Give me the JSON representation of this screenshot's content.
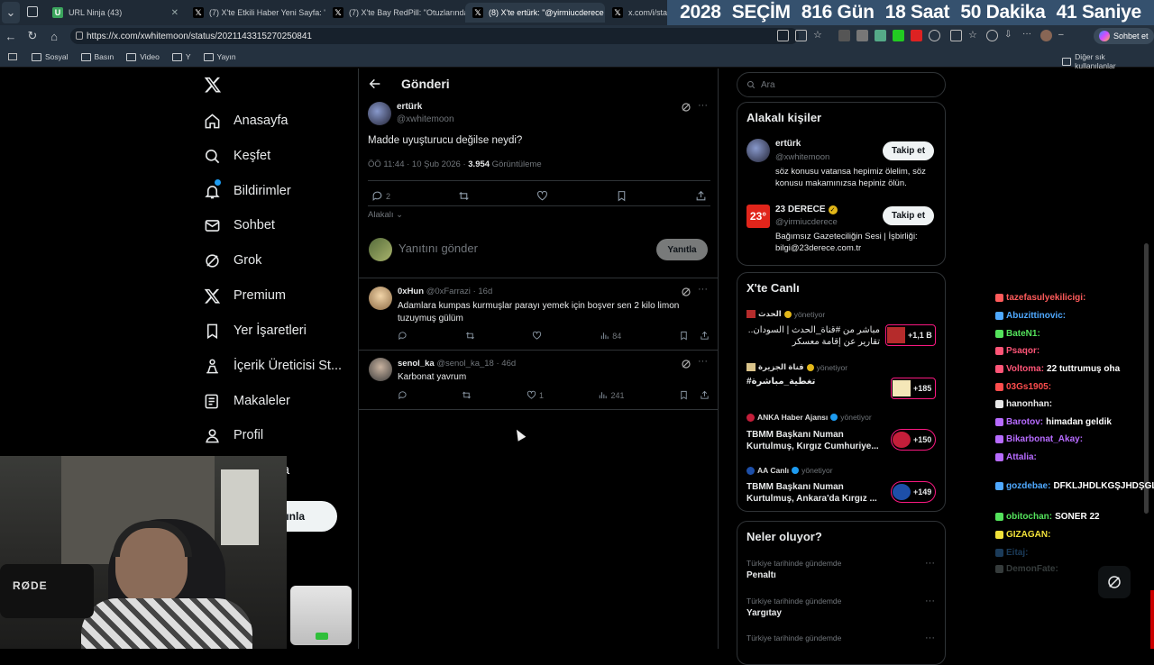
{
  "browser": {
    "tabs": [
      {
        "label": "URL Ninja (43)"
      },
      {
        "label": "(7) X'te Etkili Haber Yeni Sayfa: \"E"
      },
      {
        "label": "(7) X'te Bay RedPill: \"Otuzlarında"
      },
      {
        "label": "(8) X'te ertürk: \"@yirmiucderece b"
      },
      {
        "label": "x.com/i/status"
      }
    ],
    "url": "https://x.com/xwhitemoon/status/2021143315270250841",
    "sohbet_label": "Sohbet et",
    "bookmarks": [
      "Sosyal",
      "Basın",
      "Video",
      "Y",
      "Yayın"
    ],
    "other_bookmarks": "Diğer sık kullanılanlar"
  },
  "countdown": {
    "year": "2028",
    "label": "SEÇİM",
    "days": "816 Gün",
    "hours": "18 Saat",
    "minutes": "50 Dakika",
    "seconds": "41 Saniye"
  },
  "nav": {
    "items": [
      "Anasayfa",
      "Keşfet",
      "Bildirimler",
      "Sohbet",
      "Grok",
      "Premium",
      "Yer İşaretleri",
      "İçerik Üreticisi St...",
      "Makaleler",
      "Profil"
    ],
    "partial_item": "a",
    "post_button": "ınla"
  },
  "post": {
    "header": "Gönderi",
    "author_name": "ertürk",
    "author_handle": "@xwhitemoon",
    "text": "Madde uyuşturucu değilse neydi?",
    "meta_time": "ÖÖ 11:44 · 10 Şub 2026 · ",
    "views": "3.954",
    "views_label": " Görüntüleme",
    "reply_count": "2",
    "sort_label": "Alakalı",
    "reply_placeholder": "Yanıtını gönder",
    "reply_button": "Yanıtla"
  },
  "replies": [
    {
      "name": "0xHun",
      "handle": "@0xFarrazi",
      "time": "16d",
      "text": "Adamlara kumpas kurmuşlar parayı yemek için boşver sen  2 kilo limon tuzuymuş gülüm",
      "replies": "",
      "likes": "",
      "views": "84"
    },
    {
      "name": "senol_ka",
      "handle": "@senol_ka_18",
      "time": "46d",
      "text": "Karbonat yavrum",
      "replies": "",
      "likes": "1",
      "views": "241"
    }
  ],
  "search": {
    "placeholder": "Ara"
  },
  "related": {
    "title": "Alakalı kişiler",
    "people": [
      {
        "name": "ertürk",
        "handle": "@xwhitemoon",
        "bio": "söz konusu vatansa hepimiz ölelim, söz konusu makamınızsa hepiniz ölün.",
        "button": "Takip et"
      },
      {
        "name": "23 DERECE",
        "handle": "@yirmiucderece",
        "bio": "Bağımsız Gazeteciliğin Sesi | İşbirliği: bilgi@23derece.com.tr",
        "button": "Takip et"
      }
    ]
  },
  "live": {
    "title": "X'te Canlı",
    "items": [
      {
        "host": "الحدث",
        "role": "yönetiyor",
        "text": "مباشر من #قناة_الحدث | السودان.. تقارير عن إقامة معسكر",
        "count": "+1,1 B"
      },
      {
        "host": "قناة الجزيرة",
        "role": "yönetiyor",
        "text": "#تغطية_مباشرة",
        "count": "+185"
      },
      {
        "host": "ANKA Haber Ajansı",
        "role": "yönetiyor",
        "text": "TBMM Başkanı Numan Kurtulmuş, Kırgız Cumhuriye...",
        "count": "+150"
      },
      {
        "host": "AA Canlı",
        "role": "yönetiyor",
        "text": "TBMM Başkanı Numan Kurtulmuş, Ankara'da Kırgız ...",
        "count": "+149"
      }
    ]
  },
  "trends": {
    "title": "Neler oluyor?",
    "items": [
      {
        "context": "Türkiye tarihinde gündemde",
        "name": "Penaltı"
      },
      {
        "context": "Türkiye tarihinde gündemde",
        "name": "Yargıtay"
      },
      {
        "context": "Türkiye tarihinde gündemde",
        "name": ""
      }
    ]
  },
  "chat": [
    {
      "user": "tazefasulyekilicigi:",
      "msg": "",
      "color": "#ff5b5b"
    },
    {
      "user": "Abuzittinovic:",
      "msg": "",
      "color": "#4fa9ff"
    },
    {
      "user": "BateN1:",
      "msg": "",
      "color": "#54e35c"
    },
    {
      "user": "Psaqor:",
      "msg": "",
      "color": "#ff5577"
    },
    {
      "user": "Voltoma:",
      "msg": "22 tuttrumuş oha",
      "color": "#ff5577"
    },
    {
      "user": "03Gs1905:",
      "msg": "",
      "color": "#ff4d4d"
    },
    {
      "user": "hanonhan:",
      "msg": "",
      "color": "#e8e8e8"
    },
    {
      "user": "Barotov:",
      "msg": "himadan geldik",
      "color": "#b76bff"
    },
    {
      "user": "Bikarbonat_Akay:",
      "msg": "",
      "color": "#b76bff"
    },
    {
      "user": "Attalia:",
      "msg": "",
      "color": "#b76bff"
    },
    {
      "user": "gozdebae:",
      "msg": "DFKLJHDLKGŞJHDŞGLKJHŞ",
      "color": "#4fa9ff"
    },
    {
      "user": "obitochan:",
      "msg": "SONER 22",
      "color": "#54e35c"
    },
    {
      "user": "GIZAGAN:",
      "msg": "",
      "color": "#f2e23a"
    },
    {
      "user": "Eitaj:",
      "msg": "",
      "color": "#4fa9ff"
    },
    {
      "user": "DemonFate:",
      "msg": "",
      "color": "#9aa"
    }
  ]
}
